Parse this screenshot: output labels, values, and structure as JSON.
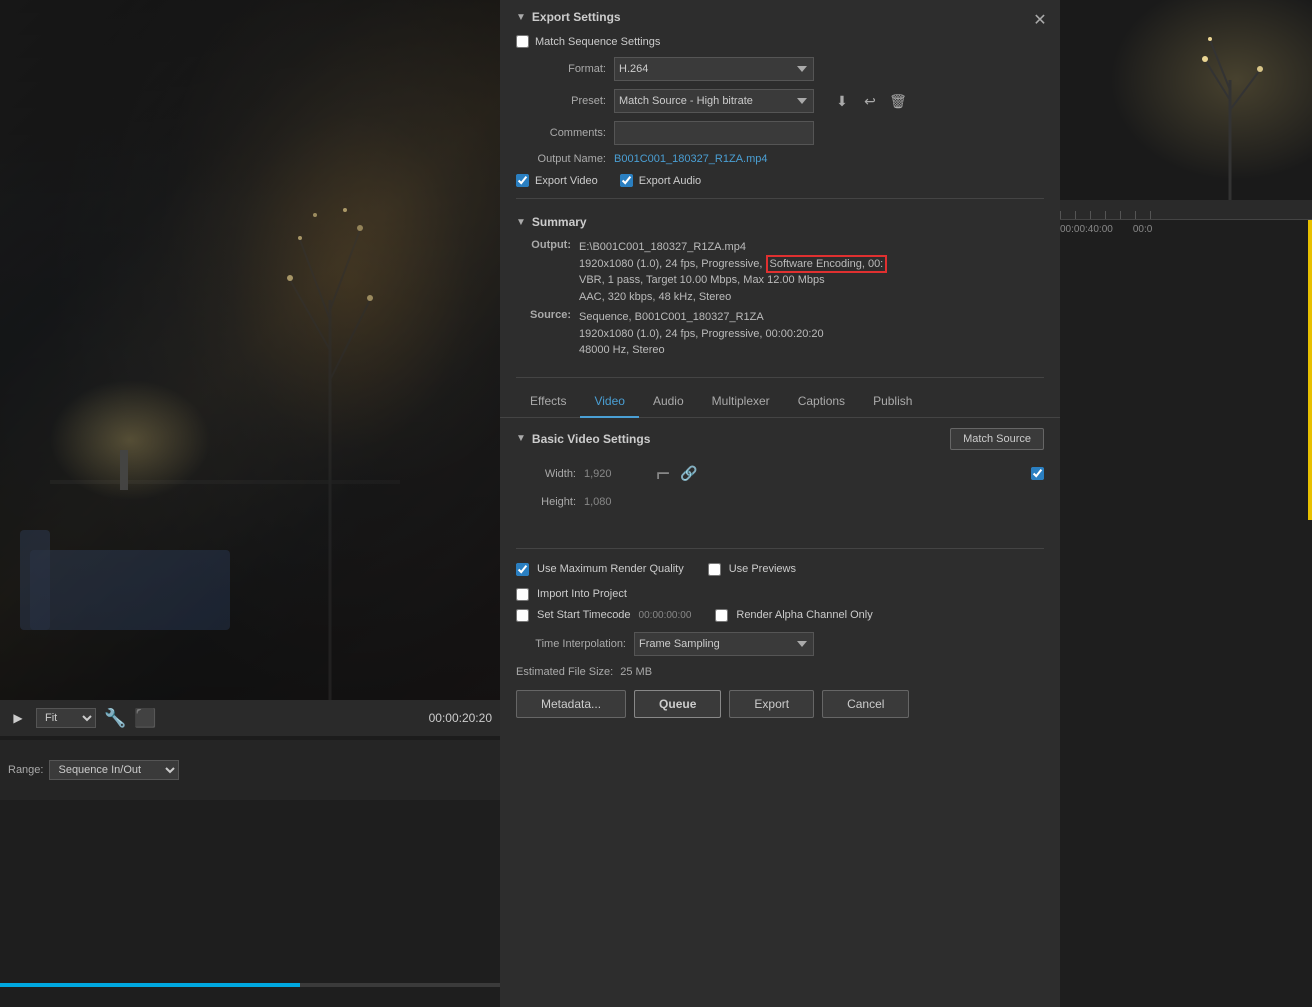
{
  "titlebar": {
    "minimize_label": "—",
    "maximize_label": "□",
    "close_label": "✕"
  },
  "dialog": {
    "close_label": "✕",
    "export_settings_label": "Export Settings",
    "match_sequence_label": "Match Sequence Settings",
    "format_label": "Format:",
    "format_value": "H.264",
    "preset_label": "Preset:",
    "preset_value": "Match Source - High bitrate",
    "comments_label": "Comments:",
    "comments_placeholder": "",
    "output_name_label": "Output Name:",
    "output_name_value": "B001C001_180327_R1ZA.mp4",
    "export_video_label": "Export Video",
    "export_audio_label": "Export Audio",
    "summary_label": "Summary",
    "summary_output_key": "Output:",
    "summary_output_val": "E:\\B001C001_180327_R1ZA.mp4\n1920x1080 (1.0), 24 fps, Progressive, Software Encoding, 00:\nVBR, 1 pass, Target 10.00 Mbps, Max 12.00 Mbps\nAAC, 320 kbps, 48 kHz, Stereo",
    "summary_source_key": "Source:",
    "summary_source_val": "Sequence, B001C001_180327_R1ZA\n1920x1080 (1.0), 24 fps, Progressive, 00:00:20:20\n48000 Hz, Stereo",
    "tabs": [
      "Effects",
      "Video",
      "Audio",
      "Multiplexer",
      "Captions",
      "Publish"
    ],
    "active_tab": "Video",
    "basic_video_settings_label": "Basic Video Settings",
    "match_source_btn": "Match Source",
    "width_label": "Width:",
    "width_value": "1,920",
    "height_label": "Height:",
    "height_value": "1,080"
  },
  "bottom_options": {
    "use_max_render_label": "Use Maximum Render Quality",
    "use_previews_label": "Use Previews",
    "import_into_project_label": "Import Into Project",
    "set_start_timecode_label": "Set Start Timecode",
    "timecode_value": "00:00:00:00",
    "render_alpha_label": "Render Alpha Channel Only",
    "time_interpolation_label": "Time Interpolation:",
    "frame_sampling_label": "Frame Sampling",
    "file_size_label": "Estimated File Size:",
    "file_size_value": "25 MB",
    "metadata_btn": "Metadata...",
    "queue_btn": "Queue",
    "export_btn": "Export",
    "cancel_btn": "Cancel"
  },
  "video_controls": {
    "fit_label": "Fit",
    "timecode": "00:00:20:20"
  },
  "range_bar": {
    "label": "Range:",
    "value": "Sequence In/Out"
  },
  "right_panel": {
    "timecode_left": "00:00:40:00",
    "timecode_right": "00:0"
  }
}
